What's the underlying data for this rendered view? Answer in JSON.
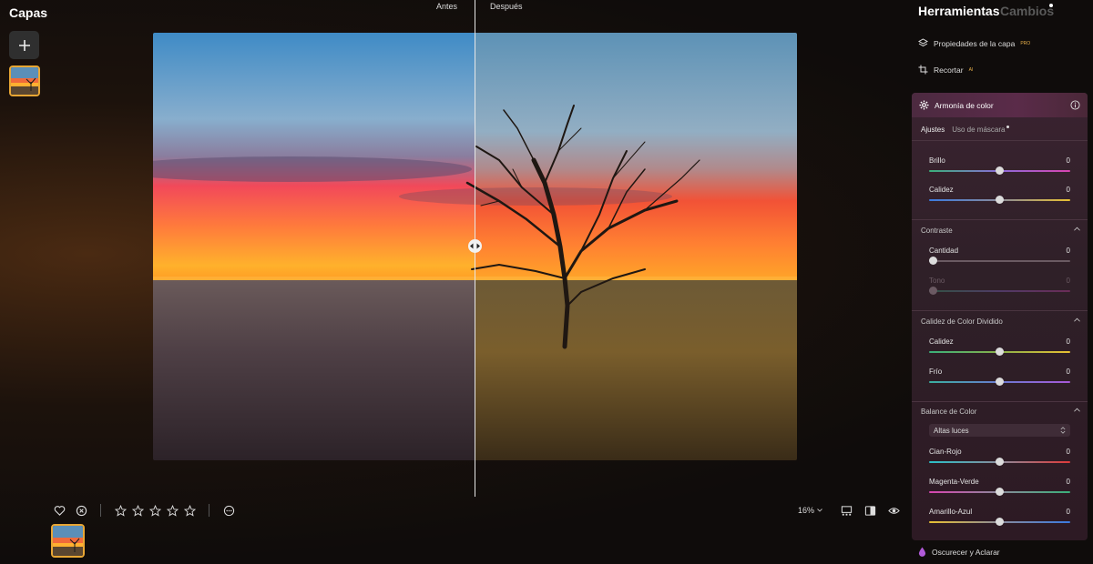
{
  "layers_panel": {
    "title": "Capas"
  },
  "canvas": {
    "before_label": "Antes",
    "after_label": "Después",
    "zoom_label": "16%",
    "stars": 0
  },
  "right_panel": {
    "tools_title": "Herramientas",
    "changes_title": "Cambios",
    "menu": [
      {
        "label": "Propiedades de la capa",
        "badge": "PRO",
        "icon": "layers-icon"
      },
      {
        "label": "Recortar",
        "badge": "AI",
        "icon": "crop-icon"
      }
    ],
    "color_harmony": {
      "title": "Armonía de color",
      "tabs": [
        "Ajustes",
        "Uso de máscara"
      ],
      "brightness": {
        "label": "Brillo",
        "value": "0"
      },
      "warmth": {
        "label": "Calidez",
        "value": "0"
      },
      "contrast": {
        "title": "Contraste",
        "amount": {
          "label": "Cantidad",
          "value": "0"
        },
        "tone": {
          "label": "Tono",
          "value": "0"
        }
      },
      "split_toning": {
        "title": "Calidez de Color Dividido",
        "warmth": {
          "label": "Calidez",
          "value": "0"
        },
        "cold": {
          "label": "Frío",
          "value": "0"
        }
      },
      "color_balance": {
        "title": "Balance de Color",
        "range_select": "Altas luces",
        "cyan_red": {
          "label": "Cian-Rojo",
          "value": "0"
        },
        "magenta_green": {
          "label": "Magenta-Verde",
          "value": "0"
        },
        "yellow_blue": {
          "label": "Amarillo-Azul",
          "value": "0"
        }
      }
    },
    "dodge_burn": {
      "label": "Oscurecer y Aclarar"
    }
  },
  "colors": {
    "accent": "#e8a634",
    "panel": "#2f2028"
  }
}
